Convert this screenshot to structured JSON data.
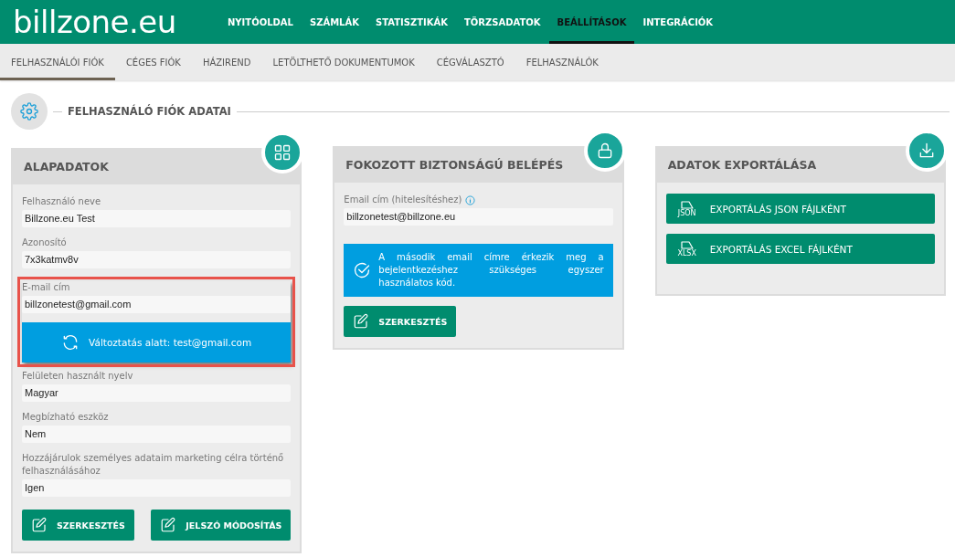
{
  "logo": "billzone.eu",
  "nav": [
    {
      "label": "NYITÓOLDAL",
      "selected": false
    },
    {
      "label": "SZÁMLÁK",
      "selected": false
    },
    {
      "label": "STATISZTIKÁK",
      "selected": false
    },
    {
      "label": "TÖRZSADATOK",
      "selected": false
    },
    {
      "label": "BEÁLLÍTÁSOK",
      "selected": true
    },
    {
      "label": "INTEGRÁCIÓK",
      "selected": false
    }
  ],
  "subnav": [
    {
      "label": "FELHASZNÁLÓI FIÓK",
      "selected": true
    },
    {
      "label": "CÉGES FIÓK",
      "selected": false
    },
    {
      "label": "HÁZIREND",
      "selected": false
    },
    {
      "label": "LETÖLTHETŐ DOKUMENTUMOK",
      "selected": false
    },
    {
      "label": "CÉGVÁLASZTÓ",
      "selected": false
    },
    {
      "label": "FELHASZNÁLÓK",
      "selected": false
    }
  ],
  "section": {
    "title": "FELHASZNÁLÓ FIÓK ADATAI"
  },
  "cards": [
    {
      "kind": "grid",
      "title": "ALAPADATOK",
      "fields": [
        {
          "label": "Felhasználó neve",
          "value": "Billzone.eu Test",
          "highlighted": false
        },
        {
          "label": "Azonosító",
          "value": "7x3katmv8v",
          "highlighted": false
        },
        {
          "label": "E-mail cím",
          "value": "billzonetest@gmail.com",
          "highlighted": true,
          "pending": "Változtatás alatt: test@gmail.com"
        },
        {
          "label": "Felületen használt nyelv",
          "value": "Magyar",
          "highlighted": false
        },
        {
          "label": "Megbízható eszköz",
          "value": "Nem",
          "highlighted": false
        },
        {
          "label": "Hozzájárulok személyes adataim marketing célra történő felhasználásához",
          "value": "Igen",
          "highlighted": false
        }
      ],
      "buttons": [
        "SZERKESZTÉS",
        "JELSZÓ MÓDOSÍTÁS"
      ]
    },
    {
      "kind": "lock",
      "title": "FOKOZOTT BIZTONSÁGÚ BELÉPÉS",
      "fields": [
        {
          "label": "Email cím (hitelesítéshez)",
          "value": "billzonetest@billzone.eu",
          "highlighted": false,
          "info": true
        }
      ],
      "notice": "A második email címre érkezik meg a bejelentkezéshez szükséges egyszer használatos kód.",
      "buttons": [
        "SZERKESZTÉS"
      ]
    },
    {
      "kind": "download",
      "title": "ADATOK EXPORTÁLÁSA",
      "exports": [
        {
          "label": "EXPORTÁLÁS JSON FÁJLKÉNT",
          "file": "JSON"
        },
        {
          "label": "EXPORTÁLÁS EXCEL FÁJLKÉNT",
          "file": "XLSX"
        }
      ]
    }
  ]
}
